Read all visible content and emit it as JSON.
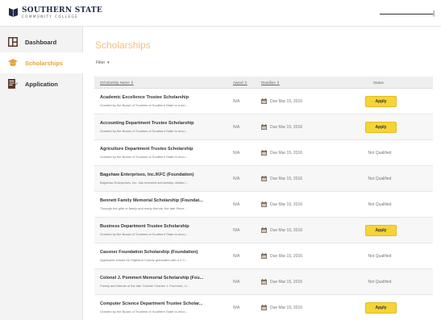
{
  "header": {
    "logo_title": "SOUTHERN STATE",
    "logo_subtitle": "COMMUNITY COLLEGE"
  },
  "sidebar": {
    "items": [
      {
        "label": "Dashboard",
        "icon": "dashboard-icon",
        "active": false
      },
      {
        "label": "Scholarships",
        "icon": "mortarboard-icon",
        "active": true
      },
      {
        "label": "Application",
        "icon": "document-edit-icon",
        "active": false
      }
    ]
  },
  "main": {
    "title": "Scholarships",
    "filter_label": "Filter",
    "filter_caret": "▾",
    "columns": {
      "name": "Scholarship Name ⇕",
      "award": "Award ⇕",
      "deadline": "Deadline ⇕",
      "status": "Status"
    },
    "rows": [
      {
        "name": "Academic Excellence Trustee Scholarship",
        "desc": "Granted by the Board of Trustees of Southern State to a ser...",
        "award": "N/A",
        "deadline": "Due Mar 15, 2016",
        "status": "Apply"
      },
      {
        "name": "Accounting Department Trustee Scholarship",
        "desc": "Granted by the Board of Trustees of Southern State to enco...",
        "award": "N/A",
        "deadline": "Due Mar 15, 2016",
        "status": "Apply"
      },
      {
        "name": "Agriculture Department Trustee Scholarship",
        "desc": "Granted by the Board of Trustees of Southern State to enco...",
        "award": "N/A",
        "deadline": "Due Mar 15, 2016",
        "status": "Not Qualified"
      },
      {
        "name": "Bagshaw Enterprises, Inc./KFC (Foundation)",
        "desc": "Bagshaw Enterprises, Inc. has invested scholarship dollars i...",
        "award": "N/A",
        "deadline": "Due Mar 15, 2016",
        "status": "Not Qualified"
      },
      {
        "name": "Bennett Family Memorial Scholarship (Foundat...",
        "desc": "Through the gifts of family and many friends, the late Steve...",
        "award": "N/A",
        "deadline": "Due Mar 15, 2016",
        "status": "Not Qualified"
      },
      {
        "name": "Business Department Trustee Scholarship",
        "desc": "Granted by the Board of Trustees of Southern State to enco...",
        "award": "N/A",
        "deadline": "Due Mar 15, 2016",
        "status": "Apply"
      },
      {
        "name": "Cassner Foundation Scholarship (Foundation)",
        "desc": "Applicants should be Highland County graduates with a 2.0...",
        "award": "N/A",
        "deadline": "Due Mar 15, 2016",
        "status": "Not Qualified"
      },
      {
        "name": "Colonel J. Pommert Memorial Scholarship (Fou...",
        "desc": "Family and friends of the late Colonel Charles J. Pommert, U...",
        "award": "N/A",
        "deadline": "Due Mar 15, 2016",
        "status": "Not Qualified"
      },
      {
        "name": "Computer Science Department Trustee Scholar...",
        "desc": "Granted by the Board of Trustees of Southern State to enco...",
        "award": "N/A",
        "deadline": "Due Mar 15, 2016",
        "status": "Apply"
      }
    ]
  },
  "colors": {
    "accent": "#e8a23a",
    "title": "#f0c080",
    "apply_button": "#f5d437",
    "sidebar_bg": "#f3f3f3"
  }
}
